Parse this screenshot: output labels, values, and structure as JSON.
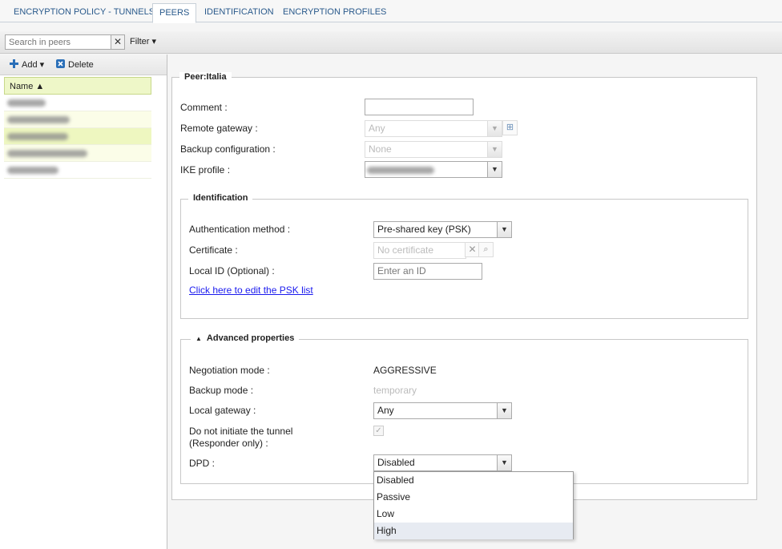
{
  "tabs": [
    "ENCRYPTION POLICY - TUNNELS",
    "PEERS",
    "IDENTIFICATION",
    "ENCRYPTION PROFILES"
  ],
  "active_tab": "PEERS",
  "toolbar": {
    "search_placeholder": "Search in peers",
    "clear_label": "✕",
    "filter_label": "Filter ▾"
  },
  "left": {
    "add_label": "Add ▾",
    "delete_label": "Delete",
    "column_name": "Name ▲"
  },
  "peer": {
    "legend": "Peer:Italia",
    "comment_label": "Comment :",
    "comment_value": "",
    "remote_gateway_label": "Remote gateway :",
    "remote_gateway_value": "Any",
    "backup_config_label": "Backup configuration :",
    "backup_config_value": "None",
    "ike_profile_label": "IKE profile :"
  },
  "identification": {
    "legend": "Identification",
    "auth_label": "Authentication method :",
    "auth_value": "Pre-shared key (PSK)",
    "cert_label": "Certificate :",
    "cert_placeholder": "No certificate",
    "localid_label": "Local ID (Optional) :",
    "localid_placeholder": "Enter an ID",
    "psk_link": "Click here to edit the PSK list"
  },
  "advanced": {
    "legend": "Advanced properties",
    "neg_label": "Negotiation mode :",
    "neg_value": "AGGRESSIVE",
    "backup_label": "Backup mode :",
    "backup_value": "temporary",
    "localgw_label": "Local gateway :",
    "localgw_value": "Any",
    "noinit_label_1": "Do not initiate the tunnel",
    "noinit_label_2": "(Responder only) :",
    "noinit_checked": true,
    "dpd_label": "DPD :",
    "dpd_value": "Disabled",
    "dpd_options": [
      "Disabled",
      "Passive",
      "Low",
      "High"
    ],
    "dpd_highlighted": "High"
  },
  "colors": {
    "tab_text": "#2a5a8c",
    "grid_header": "#eef7c8",
    "link": "#1a1aee"
  }
}
